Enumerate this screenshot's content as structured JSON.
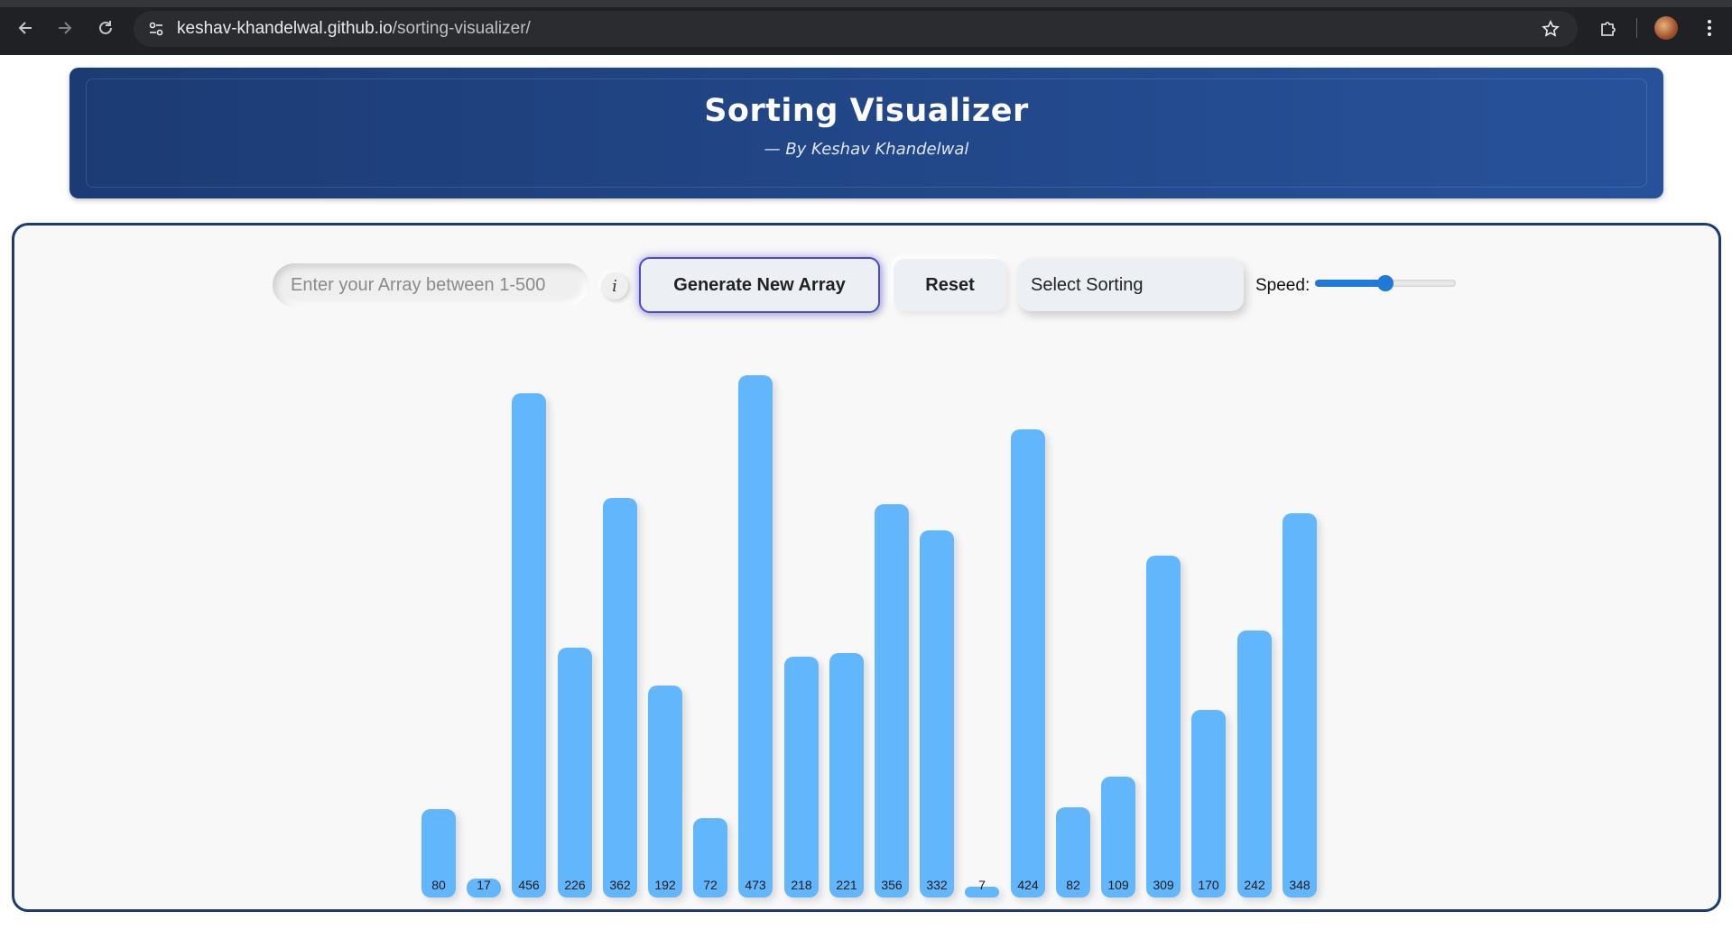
{
  "browser": {
    "url_host": "keshav-khandelwal.github.io",
    "url_path": "/sorting-visualizer/"
  },
  "header": {
    "title": "Sorting Visualizer",
    "subtitle": "— By Keshav Khandelwal"
  },
  "controls": {
    "array_input_placeholder": "Enter your Array between 1-500",
    "info_label": "i",
    "generate_label": "Generate New Array",
    "reset_label": "Reset",
    "select_label": "Select Sorting",
    "speed_label": "Speed:",
    "speed_value_fraction": 0.5
  },
  "icons": {
    "back": "back-arrow-icon",
    "forward": "forward-arrow-icon",
    "reload": "reload-icon",
    "site_info": "site-info-icon",
    "bookmark": "star-icon",
    "extensions": "puzzle-icon",
    "profile": "avatar",
    "menu": "kebab-menu-icon"
  },
  "colors": {
    "bar": "#62b6fb",
    "header_start": "#1c3b74",
    "header_end": "#27529b",
    "accent": "#1e79d8"
  },
  "chart_data": {
    "type": "bar",
    "values": [
      80,
      17,
      456,
      226,
      362,
      192,
      72,
      473,
      218,
      221,
      356,
      332,
      7,
      424,
      82,
      109,
      309,
      170,
      242,
      348
    ],
    "ylim": [
      0,
      500
    ]
  }
}
